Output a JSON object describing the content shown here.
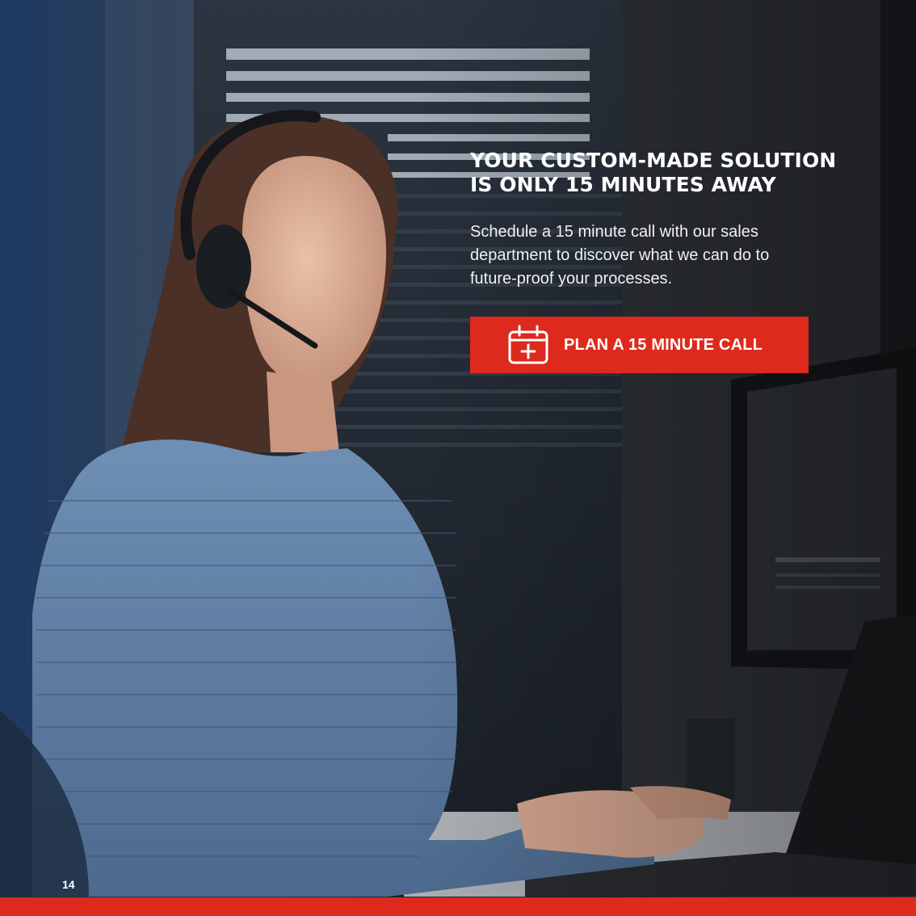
{
  "headline": {
    "line1": "YOUR CUSTOM-MADE SOLUTION",
    "line2": "IS ONLY 15 MINUTES AWAY"
  },
  "body": {
    "line1": "Schedule a 15 minute call with our sales",
    "line2": "department to discover what we can do to",
    "line3": "future-proof your processes."
  },
  "cta": {
    "label": "PLAN A 15 MINUTE CALL",
    "icon": "calendar-add-icon"
  },
  "page_number": "14",
  "colors": {
    "accent": "#dd2a1d",
    "text": "#ffffff"
  }
}
